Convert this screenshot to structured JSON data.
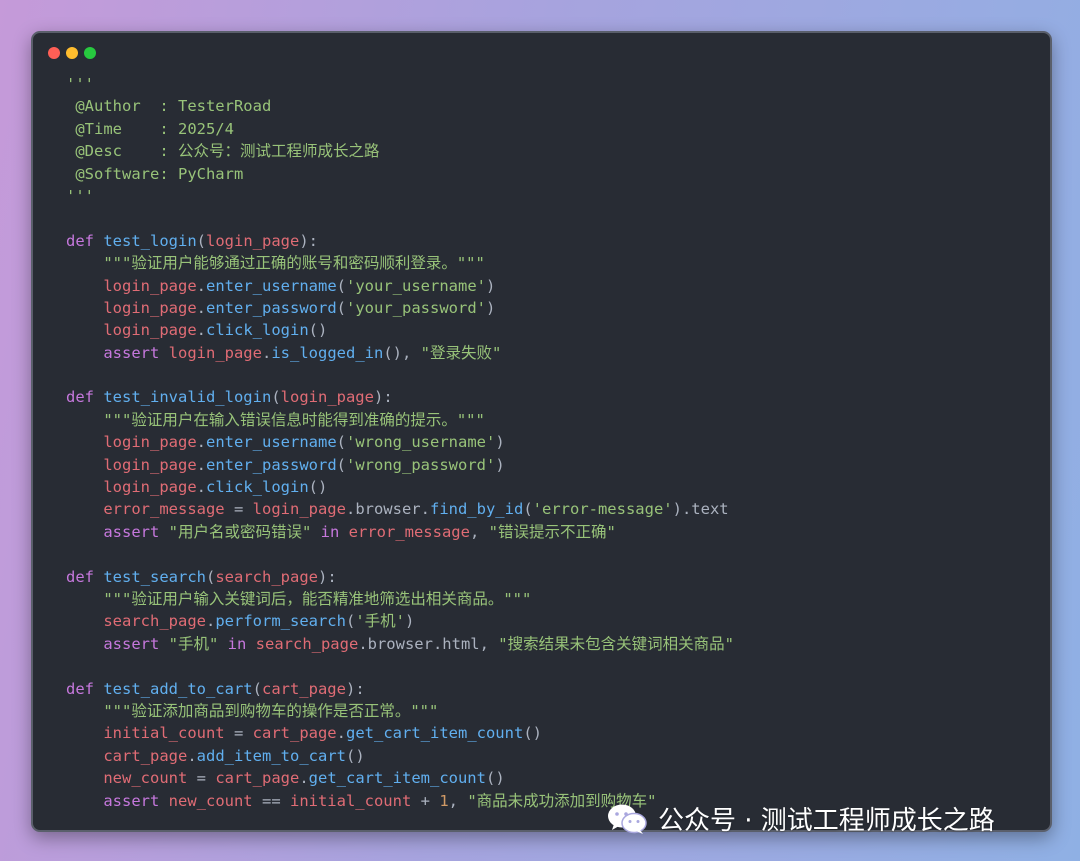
{
  "window": {
    "traffic_lights": {
      "close": "#ff5f56",
      "minimize": "#ffbd2e",
      "zoom": "#27c93f"
    }
  },
  "colors": {
    "background": "#282c34",
    "keyword": "#c678dd",
    "function": "#61afef",
    "string": "#98c379",
    "variable": "#e06c75",
    "number": "#d19a66",
    "plain": "#abb2bf"
  },
  "code_lines": [
    [
      [
        "str",
        "'''"
      ]
    ],
    [
      [
        "str",
        " @Author  : TesterRoad"
      ]
    ],
    [
      [
        "str",
        " @Time    : 2025/4"
      ]
    ],
    [
      [
        "str",
        " @Desc    : 公众号：测试工程师成长之路"
      ]
    ],
    [
      [
        "str",
        " @Software: PyCharm"
      ]
    ],
    [
      [
        "str",
        "'''"
      ]
    ],
    [],
    [
      [
        "kw",
        "def "
      ],
      [
        "fn",
        "test_login"
      ],
      [
        "pl",
        "("
      ],
      [
        "var",
        "login_page"
      ],
      [
        "pl",
        "):"
      ]
    ],
    [
      [
        "pl",
        "    "
      ],
      [
        "str",
        "\"\"\"验证用户能够通过正确的账号和密码顺利登录。\"\"\""
      ]
    ],
    [
      [
        "pl",
        "    "
      ],
      [
        "var",
        "login_page"
      ],
      [
        "pl",
        "."
      ],
      [
        "fn",
        "enter_username"
      ],
      [
        "pl",
        "("
      ],
      [
        "str",
        "'your_username'"
      ],
      [
        "pl",
        ")"
      ]
    ],
    [
      [
        "pl",
        "    "
      ],
      [
        "var",
        "login_page"
      ],
      [
        "pl",
        "."
      ],
      [
        "fn",
        "enter_password"
      ],
      [
        "pl",
        "("
      ],
      [
        "str",
        "'your_password'"
      ],
      [
        "pl",
        ")"
      ]
    ],
    [
      [
        "pl",
        "    "
      ],
      [
        "var",
        "login_page"
      ],
      [
        "pl",
        "."
      ],
      [
        "fn",
        "click_login"
      ],
      [
        "pl",
        "()"
      ]
    ],
    [
      [
        "pl",
        "    "
      ],
      [
        "kw",
        "assert "
      ],
      [
        "var",
        "login_page"
      ],
      [
        "pl",
        "."
      ],
      [
        "fn",
        "is_logged_in"
      ],
      [
        "pl",
        "(), "
      ],
      [
        "str",
        "\"登录失败\""
      ]
    ],
    [],
    [
      [
        "kw",
        "def "
      ],
      [
        "fn",
        "test_invalid_login"
      ],
      [
        "pl",
        "("
      ],
      [
        "var",
        "login_page"
      ],
      [
        "pl",
        "):"
      ]
    ],
    [
      [
        "pl",
        "    "
      ],
      [
        "str",
        "\"\"\"验证用户在输入错误信息时能得到准确的提示。\"\"\""
      ]
    ],
    [
      [
        "pl",
        "    "
      ],
      [
        "var",
        "login_page"
      ],
      [
        "pl",
        "."
      ],
      [
        "fn",
        "enter_username"
      ],
      [
        "pl",
        "("
      ],
      [
        "str",
        "'wrong_username'"
      ],
      [
        "pl",
        ")"
      ]
    ],
    [
      [
        "pl",
        "    "
      ],
      [
        "var",
        "login_page"
      ],
      [
        "pl",
        "."
      ],
      [
        "fn",
        "enter_password"
      ],
      [
        "pl",
        "("
      ],
      [
        "str",
        "'wrong_password'"
      ],
      [
        "pl",
        ")"
      ]
    ],
    [
      [
        "pl",
        "    "
      ],
      [
        "var",
        "login_page"
      ],
      [
        "pl",
        "."
      ],
      [
        "fn",
        "click_login"
      ],
      [
        "pl",
        "()"
      ]
    ],
    [
      [
        "pl",
        "    "
      ],
      [
        "var",
        "error_message"
      ],
      [
        "pl",
        " = "
      ],
      [
        "var",
        "login_page"
      ],
      [
        "pl",
        ".browser."
      ],
      [
        "fn",
        "find_by_id"
      ],
      [
        "pl",
        "("
      ],
      [
        "str",
        "'error-message'"
      ],
      [
        "pl",
        ").text"
      ]
    ],
    [
      [
        "pl",
        "    "
      ],
      [
        "kw",
        "assert "
      ],
      [
        "str",
        "\"用户名或密码错误\""
      ],
      [
        "kw",
        " in "
      ],
      [
        "var",
        "error_message"
      ],
      [
        "pl",
        ", "
      ],
      [
        "str",
        "\"错误提示不正确\""
      ]
    ],
    [],
    [
      [
        "kw",
        "def "
      ],
      [
        "fn",
        "test_search"
      ],
      [
        "pl",
        "("
      ],
      [
        "var",
        "search_page"
      ],
      [
        "pl",
        "):"
      ]
    ],
    [
      [
        "pl",
        "    "
      ],
      [
        "str",
        "\"\"\"验证用户输入关键词后，能否精准地筛选出相关商品。\"\"\""
      ]
    ],
    [
      [
        "pl",
        "    "
      ],
      [
        "var",
        "search_page"
      ],
      [
        "pl",
        "."
      ],
      [
        "fn",
        "perform_search"
      ],
      [
        "pl",
        "("
      ],
      [
        "str",
        "'手机'"
      ],
      [
        "pl",
        ")"
      ]
    ],
    [
      [
        "pl",
        "    "
      ],
      [
        "kw",
        "assert "
      ],
      [
        "str",
        "\"手机\""
      ],
      [
        "kw",
        " in "
      ],
      [
        "var",
        "search_page"
      ],
      [
        "pl",
        ".browser.html, "
      ],
      [
        "str",
        "\"搜索结果未包含关键词相关商品\""
      ]
    ],
    [],
    [
      [
        "kw",
        "def "
      ],
      [
        "fn",
        "test_add_to_cart"
      ],
      [
        "pl",
        "("
      ],
      [
        "var",
        "cart_page"
      ],
      [
        "pl",
        "):"
      ]
    ],
    [
      [
        "pl",
        "    "
      ],
      [
        "str",
        "\"\"\"验证添加商品到购物车的操作是否正常。\"\"\""
      ]
    ],
    [
      [
        "pl",
        "    "
      ],
      [
        "var",
        "initial_count"
      ],
      [
        "pl",
        " = "
      ],
      [
        "var",
        "cart_page"
      ],
      [
        "pl",
        "."
      ],
      [
        "fn",
        "get_cart_item_count"
      ],
      [
        "pl",
        "()"
      ]
    ],
    [
      [
        "pl",
        "    "
      ],
      [
        "var",
        "cart_page"
      ],
      [
        "pl",
        "."
      ],
      [
        "fn",
        "add_item_to_cart"
      ],
      [
        "pl",
        "()"
      ]
    ],
    [
      [
        "pl",
        "    "
      ],
      [
        "var",
        "new_count"
      ],
      [
        "pl",
        " = "
      ],
      [
        "var",
        "cart_page"
      ],
      [
        "pl",
        "."
      ],
      [
        "fn",
        "get_cart_item_count"
      ],
      [
        "pl",
        "()"
      ]
    ],
    [
      [
        "pl",
        "    "
      ],
      [
        "kw",
        "assert "
      ],
      [
        "var",
        "new_count"
      ],
      [
        "pl",
        " == "
      ],
      [
        "var",
        "initial_count"
      ],
      [
        "pl",
        " + "
      ],
      [
        "num",
        "1"
      ],
      [
        "pl",
        ", "
      ],
      [
        "str",
        "\"商品未成功添加到购物车\""
      ]
    ]
  ],
  "watermark": {
    "icon": "wechat-icon",
    "text": "公众号 · 测试工程师成长之路"
  }
}
